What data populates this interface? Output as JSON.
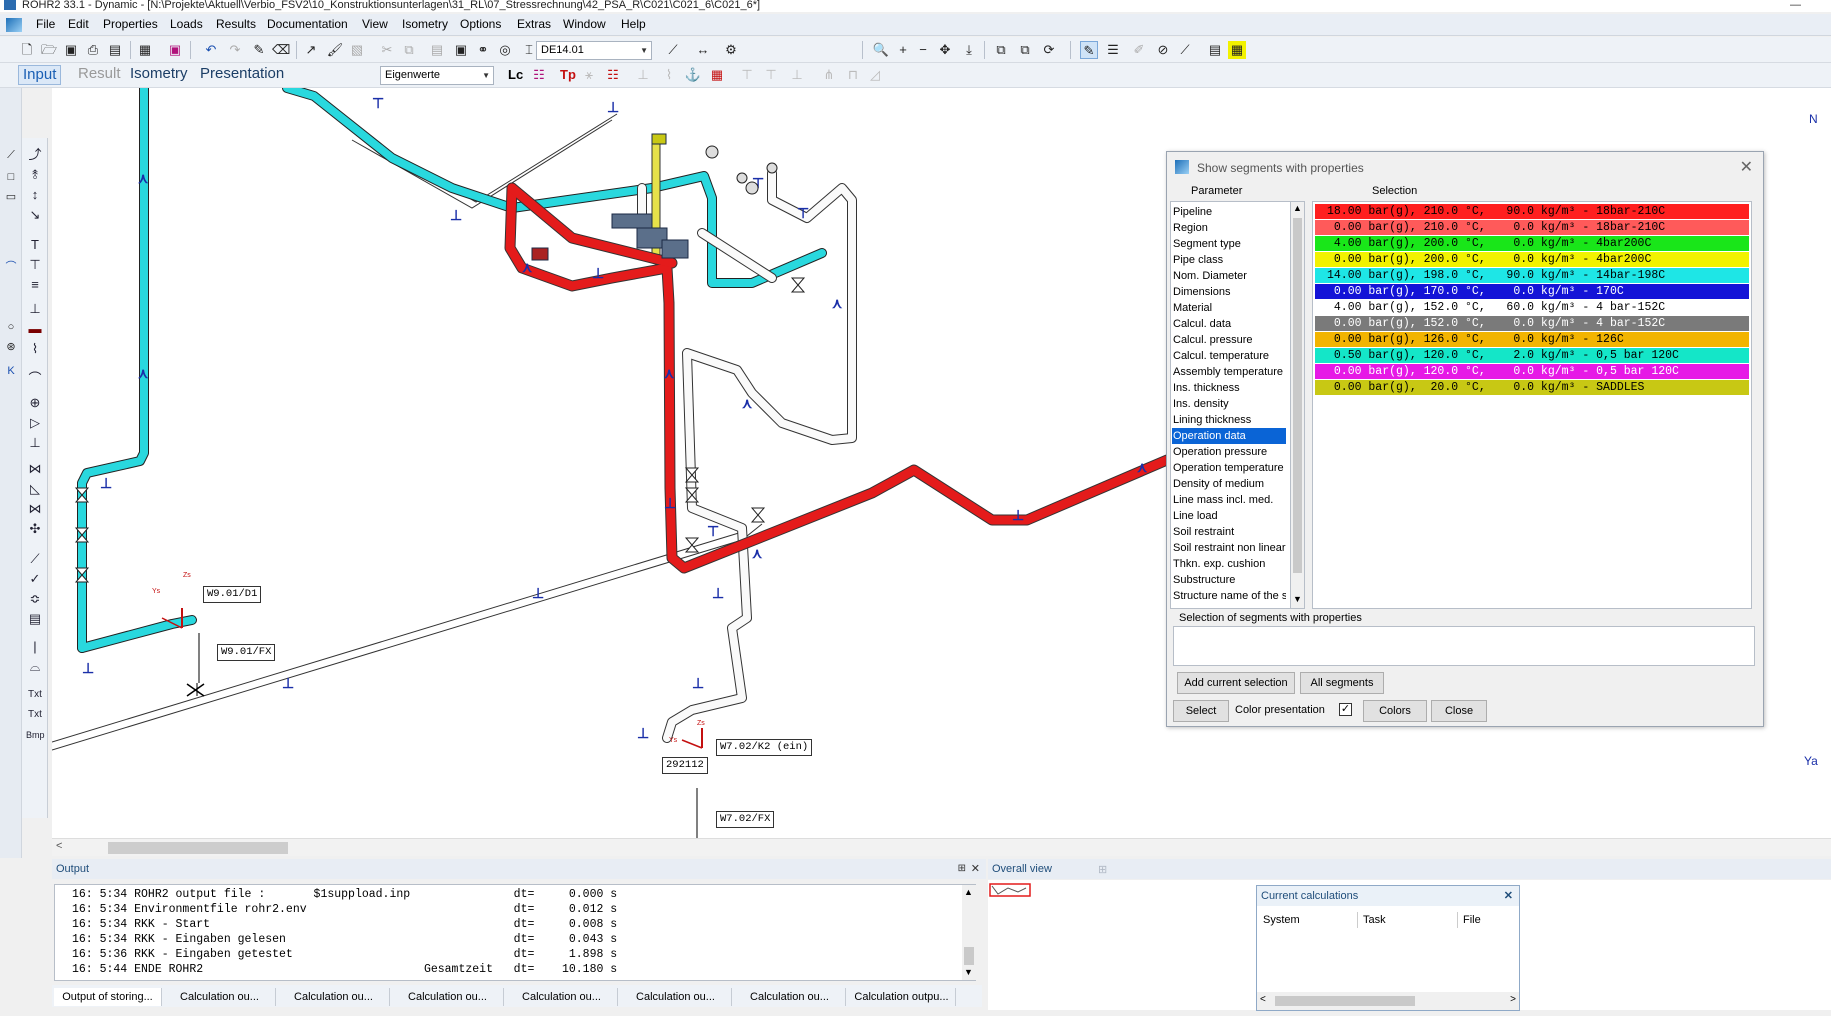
{
  "window": {
    "title": "ROHR2 33.1 - Dynamic - [N:\\Projekte\\Aktuell\\Verbio_FSV2\\10_Konstruktionsunterlagen\\31_RL\\07_Stressrechnung\\42_PSA_R\\C021\\C021_6\\C021_6*]"
  },
  "menu": [
    "File",
    "Edit",
    "Properties",
    "Loads",
    "Results",
    "Documentation",
    "View",
    "Isometry",
    "Options",
    "Extras",
    "Window",
    "Help"
  ],
  "toolbar": {
    "combo1": "DE14.01",
    "combo2": "Eigenwerte",
    "lc_label": "Lc",
    "tp_label": "Tp"
  },
  "modes": {
    "input": "Input",
    "result": "Result",
    "isometry": "Isometry",
    "presentation": "Presentation"
  },
  "left_tools": {
    "txt1": "Txt",
    "txt2": "Txt",
    "bmp": "Bmp"
  },
  "canvas": {
    "axis_n": "N",
    "axis_ya": "Ya",
    "labels": {
      "w901d1": "W9.01/D1",
      "w901fx": "W9.01/FX",
      "w702k2": "W7.02/K2 (ein)",
      "w702fx": "W7.02/FX",
      "node": "292112",
      "ys1": "Ys",
      "zs1": "Zs",
      "ys2": "Ys",
      "zs2": "Zs"
    }
  },
  "dialog": {
    "title": "Show segments with properties",
    "parameter_header": "Parameter",
    "selection_header": "Selection",
    "parameters": [
      "Pipeline",
      "Region",
      "Segment type",
      "Pipe class",
      "Nom. Diameter",
      "Dimensions",
      "Material",
      "Calcul. data",
      "Calcul. pressure",
      "Calcul. temperature",
      "Assembly temperature",
      "Ins. thickness",
      "Ins. density",
      "Lining thickness",
      "Operation data",
      "Operation pressure",
      "Operation temperature",
      "Density of medium",
      "Line mass incl. med.",
      "Line load",
      "Soil restraint",
      "Soil restraint non linear",
      "Thkn. exp. cushion",
      "Substructure",
      "Structure name of the s"
    ],
    "selected_parameter": "Operation data",
    "selections": [
      {
        "text": "18.00 bar(g), 210.0 °C,   90.0 kg/m³ - 18bar-210C",
        "color": "#ff1f1f",
        "fg": "#000000"
      },
      {
        "text": " 0.00 bar(g), 210.0 °C,    0.0 kg/m³ - 18bar-210C",
        "color": "#ff5a5a",
        "fg": "#000000"
      },
      {
        "text": " 4.00 bar(g), 200.0 °C,    0.0 kg/m³ - 4bar200C",
        "color": "#19e619",
        "fg": "#000000"
      },
      {
        "text": " 0.00 bar(g), 200.0 °C,    0.0 kg/m³ - 4bar200C",
        "color": "#f2f200",
        "fg": "#000000"
      },
      {
        "text": "14.00 bar(g), 198.0 °C,   90.0 kg/m³ - 14bar-198C",
        "color": "#1ee6e6",
        "fg": "#000000"
      },
      {
        "text": " 0.00 bar(g), 170.0 °C,    0.0 kg/m³ - 170C",
        "color": "#1414d7",
        "fg": "#ffffff"
      },
      {
        "text": " 4.00 bar(g), 152.0 °C,   60.0 kg/m³ - 4 bar-152C",
        "color": "#ffffff",
        "fg": "#000000"
      },
      {
        "text": " 0.00 bar(g), 152.0 °C,    0.0 kg/m³ - 4 bar-152C",
        "color": "#7a7a7a",
        "fg": "#ffffff"
      },
      {
        "text": " 0.00 bar(g), 126.0 °C,    0.0 kg/m³ - 126C",
        "color": "#f2b400",
        "fg": "#000000"
      },
      {
        "text": " 0.50 bar(g), 120.0 °C,    2.0 kg/m³ - 0,5 bar 120C",
        "color": "#14e6c8",
        "fg": "#000000"
      },
      {
        "text": " 0.00 bar(g), 120.0 °C,    0.0 kg/m³ - 0,5 bar 120C",
        "color": "#e619e6",
        "fg": "#ffffff"
      },
      {
        "text": " 0.00 bar(g),  20.0 °C,    0.0 kg/m³ - SADDLES",
        "color": "#c8c814",
        "fg": "#000000"
      }
    ],
    "selection_group_label": "Selection of segments with properties",
    "add_current_selection": "Add current selection",
    "all_segments": "All segments",
    "select": "Select",
    "color_presentation": "Color presentation",
    "color_presentation_checked": "✓",
    "colors": "Colors",
    "close": "Close"
  },
  "output": {
    "title": "Output",
    "lines": [
      "16: 5:34 ROHR2 output file :       $1suppload.inp               dt=     0.000 s",
      "16: 5:34 Environmentfile rohr2.env                              dt=     0.012 s",
      "16: 5:34 RKK - Start                                            dt=     0.008 s",
      "16: 5:34 RKK - Eingaben gelesen                                 dt=     0.043 s",
      "16: 5:36 RKK - Eingaben getestet                                dt=     1.898 s",
      "16: 5:44 ENDE ROHR2                                Gesamtzeit   dt=    10.180 s"
    ],
    "tabs": [
      "Output of storing...",
      "Calculation ou...",
      "Calculation ou...",
      "Calculation ou...",
      "Calculation ou...",
      "Calculation ou...",
      "Calculation ou...",
      "Calculation outpu..."
    ]
  },
  "overview": {
    "title": "Overall view"
  },
  "current_calculations": {
    "title": "Current calculations",
    "columns": [
      "System",
      "Task",
      "File"
    ]
  }
}
